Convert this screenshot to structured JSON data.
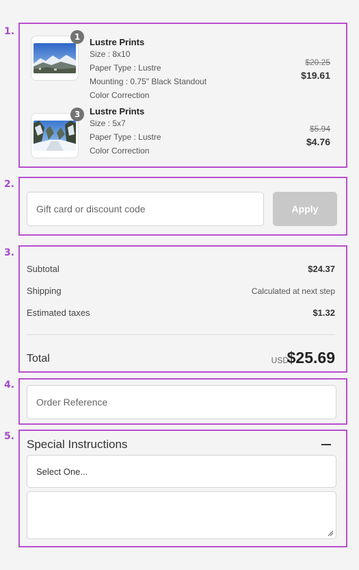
{
  "section_markers": [
    "1.",
    "2.",
    "3.",
    "4.",
    "5."
  ],
  "cart": {
    "items": [
      {
        "thumbnail_icon": "mountain-landscape-photo",
        "quantity": "1",
        "name": "Lustre Prints",
        "details": [
          "Size : 8x10",
          "Paper Type : Lustre",
          "Mounting : 0.75\" Black Standout",
          "Color Correction"
        ],
        "original_price": "$20.25",
        "price": "$19.61"
      },
      {
        "thumbnail_icon": "snowy-forest-photo",
        "quantity": "3",
        "name": "Lustre Prints",
        "details": [
          "Size : 5x7",
          "Paper Type : Lustre",
          "Color Correction"
        ],
        "original_price": "$5.94",
        "price": "$4.76"
      }
    ]
  },
  "discount": {
    "placeholder": "Gift card or discount code",
    "apply_label": "Apply"
  },
  "summary": {
    "subtotal_label": "Subtotal",
    "subtotal_value": "$24.37",
    "shipping_label": "Shipping",
    "shipping_value": "Calculated at next step",
    "taxes_label": "Estimated taxes",
    "taxes_value": "$1.32",
    "total_label": "Total",
    "currency": "USD",
    "total_value": "$25.69"
  },
  "order_reference": {
    "placeholder": "Order Reference"
  },
  "special_instructions": {
    "title": "Special Instructions",
    "select_value": "Select One..."
  },
  "colors": {
    "annotation": "#b84fcf",
    "apply_button": "#c8c8c8",
    "background": "#f4f4f4"
  }
}
